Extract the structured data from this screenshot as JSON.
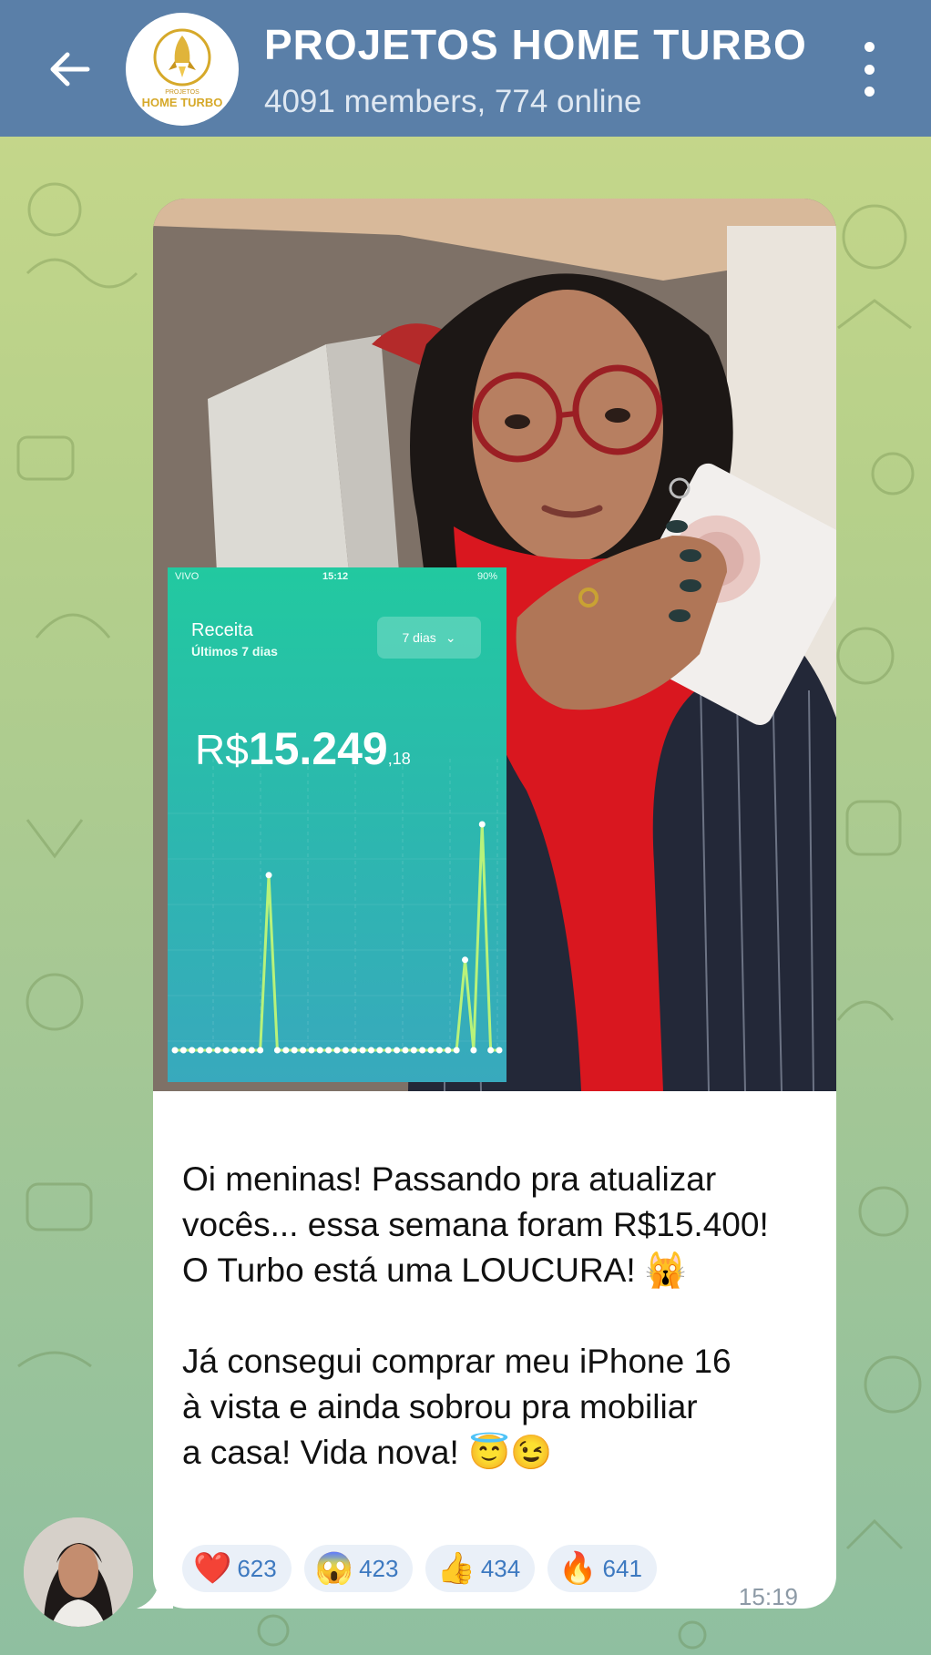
{
  "header": {
    "title": "PROJETOS HOME TURBO",
    "subtitle": "4091 members, 774 online",
    "logo_text_top": "PROJETOS",
    "logo_text_bottom": "HOME TURBO"
  },
  "message": {
    "text": "Oi meninas! Passando pra atualizar\nvocês... essa semana foram R$15.400!\nO Turbo está uma LOUCURA! 🙀\n\nJá consegui comprar meu iPhone 16\nà vista e ainda sobrou pra mobiliar\na casa! Vida nova! 😇😉",
    "time": "15:19",
    "reactions": [
      {
        "emoji": "❤️",
        "count": "623"
      },
      {
        "emoji": "😱",
        "count": "423"
      },
      {
        "emoji": "👍",
        "count": "434"
      },
      {
        "emoji": "🔥",
        "count": "641"
      }
    ]
  },
  "revenue_screenshot": {
    "carrier": "VIVO",
    "clock": "15:12",
    "battery": "90%",
    "title": "Receita",
    "subtitle": "Últimos 7 dias",
    "period": "7 dias",
    "currency": "R$",
    "amount": "15.249",
    "cents": ",18"
  },
  "chart_data": {
    "type": "line",
    "title": "",
    "xlabel": "",
    "ylabel": "",
    "series": [
      {
        "values": [
          0,
          0,
          0,
          0,
          0,
          0,
          0,
          0,
          0,
          0,
          0,
          0.62,
          0,
          0,
          0,
          0,
          0,
          0,
          0,
          0,
          0,
          0,
          0,
          0,
          0,
          0,
          0,
          0,
          0,
          0,
          0,
          0,
          0,
          0,
          0.32,
          0,
          0.8,
          0,
          0
        ]
      }
    ],
    "ylim": [
      0,
      1
    ],
    "grid": true
  },
  "colors": {
    "header_bg": "#5a7fa8",
    "reaction_count": "#3d79c0",
    "card_top": "#22c9a0",
    "card_bottom": "#38a9bd",
    "line": "#b8f27a"
  }
}
